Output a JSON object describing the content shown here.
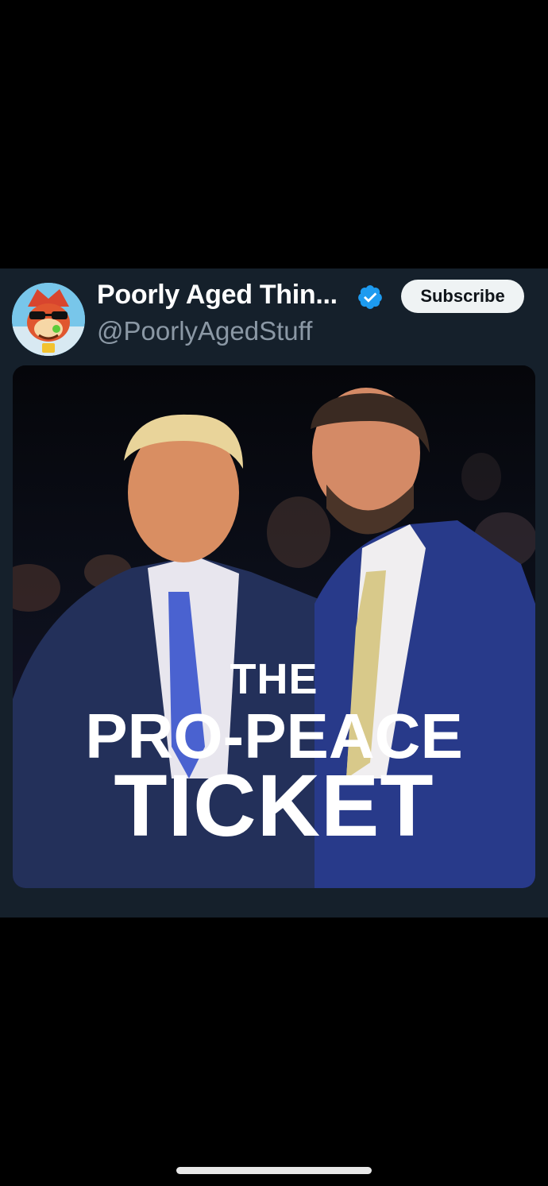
{
  "post": {
    "display_name": "Poorly Aged Thin...",
    "handle": "@PoorlyAgedStuff",
    "subscribe_label": "Subscribe",
    "verified": true
  },
  "media": {
    "headline_line_1": "THE",
    "headline_line_2": "PRO-PEACE",
    "headline_line_3": "TICKET"
  },
  "colors": {
    "background": "#000000",
    "card_background": "#15202b",
    "display_name": "#ffffff",
    "handle": "#8b98a5",
    "verified_badge": "#1d9bf0",
    "subscribe_button_bg": "#eff3f4",
    "subscribe_button_text": "#0f1419"
  },
  "icons": {
    "verified": "verified-badge-icon"
  }
}
